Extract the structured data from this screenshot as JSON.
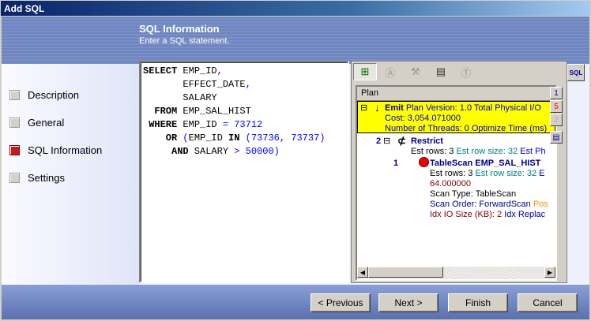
{
  "window": {
    "title": "Add SQL"
  },
  "header": {
    "title": "SQL Information",
    "subtitle": "Enter a SQL statement."
  },
  "steps": [
    {
      "label": "Description",
      "active": false
    },
    {
      "label": "General",
      "active": false
    },
    {
      "label": "SQL Information",
      "active": true
    },
    {
      "label": "Settings",
      "active": false
    }
  ],
  "sql": {
    "lines": [
      [
        [
          "kw",
          "SELECT"
        ],
        [
          "",
          "EMP_ID"
        ],
        [
          "bl",
          ","
        ]
      ],
      [
        [
          "",
          "       EFFECT_DATE"
        ],
        [
          "bl",
          ","
        ]
      ],
      [
        [
          "",
          "       SALARY"
        ]
      ],
      [
        [
          "kw",
          "  FROM"
        ],
        [
          "",
          " EMP_SAL_HIST"
        ]
      ],
      [
        [
          "kw",
          " WHERE"
        ],
        [
          "",
          " EMP_ID "
        ],
        [
          "bl",
          "= 73712"
        ]
      ],
      [
        [
          "kw",
          "    OR"
        ],
        [
          "bl",
          " ("
        ],
        [
          "",
          "EMP_ID "
        ],
        [
          "kw",
          "IN"
        ],
        [
          "bl",
          " (73736, 73737)"
        ]
      ],
      [
        [
          "kw",
          "     AND"
        ],
        [
          "",
          " SALARY "
        ],
        [
          "bl",
          "> 50000)"
        ]
      ]
    ]
  },
  "plan": {
    "header": "Plan",
    "toolbar": [
      "plan-tree",
      "abstract-plan",
      "tools",
      "report",
      "text"
    ],
    "emit": {
      "title": "Emit",
      "info": "Plan Version: 1.0  Total Physical I/O",
      "cost": "Cost: 3,054.071000",
      "threads": "Number of Threads: 0  Optimize Time (ms)"
    },
    "restrict": {
      "num": "2",
      "title": "Restrict",
      "rows": "Est rows: 3",
      "rowsize": "Est row size: 32",
      "ph": "Est Ph"
    },
    "tablescan": {
      "num": "1",
      "title": "TableScan EMP_SAL_HIST",
      "rows": "Est rows: 3",
      "rowsize": "Est row size: 32",
      "e": "E",
      "cost": "64.000000",
      "scan_type": "Scan Type: TableScan",
      "scan_order": "Scan Order: ForwardScan",
      "pos": "Pos",
      "idx_io": "Idx IO Size (KB): 2",
      "idx_repl": "Idx Replac"
    },
    "side_buttons": [
      "1",
      "5",
      "2"
    ]
  },
  "buttons": {
    "previous": "Previous",
    "next": "Next",
    "finish": "Finish",
    "cancel": "Cancel"
  }
}
